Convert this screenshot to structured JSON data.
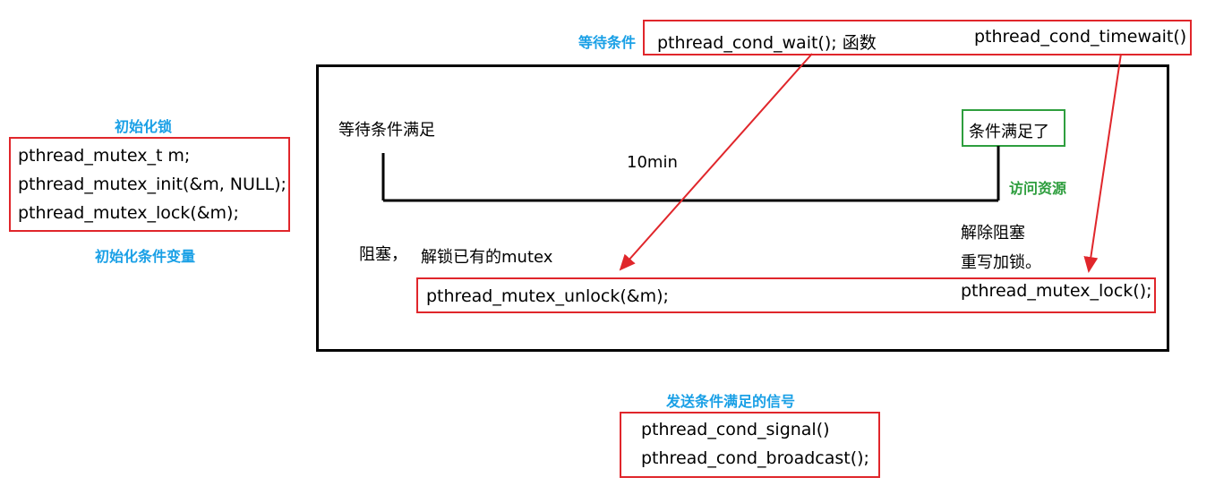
{
  "colors": {
    "label_blue": "#1aa0e6",
    "label_green": "#2e9e3e",
    "box_red": "#e0262b",
    "frame_black": "#000000"
  },
  "init_section": {
    "title": "初始化锁",
    "lines": [
      "pthread_mutex_t  m;",
      "pthread_mutex_init(&m, NULL);",
      "pthread_mutex_lock(&m);"
    ],
    "footer": "初始化条件变量"
  },
  "wait_section": {
    "label": "等待条件",
    "wait_call": "pthread_cond_wait(); 函数",
    "timewait_call": "pthread_cond_timewait()"
  },
  "timeline": {
    "start_label": "等待条件满足",
    "duration": "10min",
    "end_label": "条件满足了",
    "access_label": "访问资源",
    "block_label": "阻塞，",
    "unlock_desc": "解锁已有的mutex",
    "unlock_call": "pthread_mutex_unlock(&m);",
    "unblock_line1": "解除阻塞",
    "unblock_line2": "重写加锁。",
    "lock_call": "pthread_mutex_lock();"
  },
  "signal_section": {
    "title": "发送条件满足的信号",
    "lines": [
      "pthread_cond_signal()",
      "pthread_cond_broadcast();"
    ]
  }
}
